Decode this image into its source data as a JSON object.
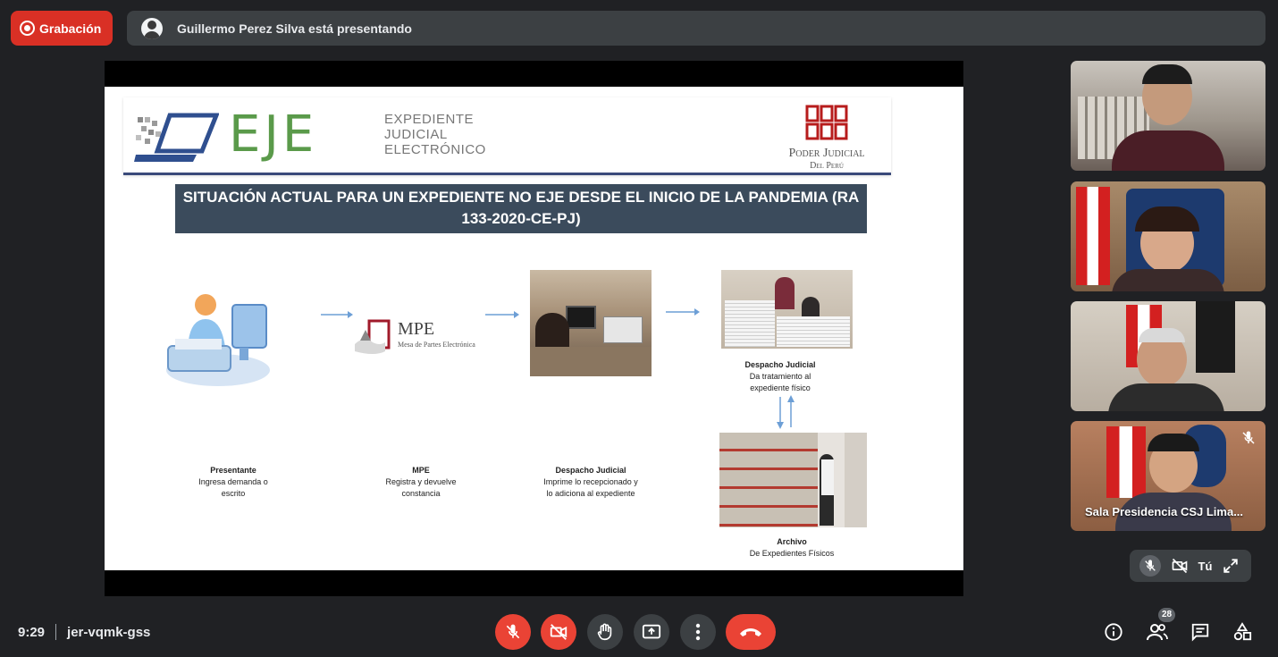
{
  "recording": {
    "label": "Grabación"
  },
  "presenter": {
    "text": "Guillermo Perez Silva está presentando"
  },
  "slide": {
    "logo": {
      "main": "EJE",
      "sub_line1": "EXPEDIENTE",
      "sub_line2": "JUDICIAL",
      "sub_line3": "ELECTRÓNICO"
    },
    "pj_logo": {
      "name": "Poder Judicial",
      "country": "Del Perú"
    },
    "title": "SITUACIÓN ACTUAL PARA UN EXPEDIENTE NO EJE DESDE EL INICIO DE LA PANDEMIA (RA 133-2020-CE-PJ)",
    "mpe": {
      "acronym": "MPE",
      "full": "Mesa de Partes Electrónica"
    },
    "steps": [
      {
        "title": "Presentante",
        "line1": "Ingresa demanda o",
        "line2": "escrito"
      },
      {
        "title": "MPE",
        "line1": "Registra y devuelve",
        "line2": "constancia"
      },
      {
        "title": "Despacho Judicial",
        "line1": "Imprime lo recepcionado y",
        "line2": "lo adiciona al expediente"
      },
      {
        "title": "Despacho Judicial",
        "line1": "Da tratamiento al",
        "line2": "expediente físico"
      },
      {
        "title": "Archivo",
        "line1": "De Expedientes Físicos",
        "line2": ""
      }
    ]
  },
  "participants": {
    "tiles": [
      {
        "id": "p1",
        "name": ""
      },
      {
        "id": "p2",
        "name": ""
      },
      {
        "id": "p3",
        "name": ""
      },
      {
        "id": "p4",
        "name": "Sala Presidencia CSJ Lima..."
      }
    ],
    "self_label": "Tú"
  },
  "meeting": {
    "time": "9:29",
    "code": "jer-vqmk-gss",
    "participant_count": "28"
  },
  "icons": [
    "record-icon",
    "mic-off-icon",
    "camera-off-icon",
    "raise-hand-icon",
    "present-icon",
    "more-icon",
    "end-call-icon",
    "info-icon",
    "people-icon",
    "chat-icon",
    "activities-icon",
    "expand-icon"
  ],
  "colors": {
    "end_call": "#ea4335",
    "bar_bg": "#3c4043",
    "page_bg": "#202124",
    "eje_green": "#5a9a4a",
    "title_bg": "#3b4b5c"
  }
}
